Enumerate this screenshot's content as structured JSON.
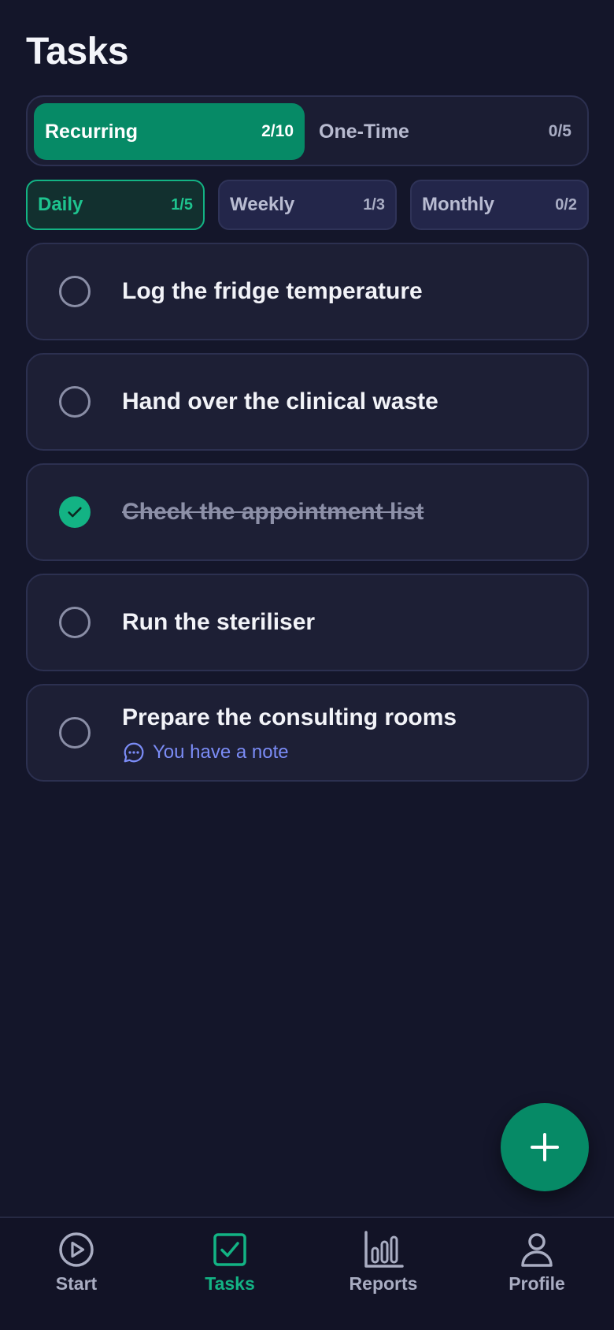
{
  "header": {
    "title": "Tasks"
  },
  "segment": {
    "tabs": [
      {
        "label": "Recurring",
        "count": "2/10",
        "active": true
      },
      {
        "label": "One-Time",
        "count": "0/5",
        "active": false
      }
    ]
  },
  "frequency": {
    "chips": [
      {
        "label": "Daily",
        "count": "1/5",
        "active": true
      },
      {
        "label": "Weekly",
        "count": "1/3",
        "active": false
      },
      {
        "label": "Monthly",
        "count": "0/2",
        "active": false
      }
    ]
  },
  "tasks": [
    {
      "title": "Log the fridge temperature",
      "done": false
    },
    {
      "title": "Hand over the clinical waste",
      "done": false
    },
    {
      "title": "Check the appointment list",
      "done": true
    },
    {
      "title": "Run the steriliser",
      "done": false
    },
    {
      "title": "Prepare the consulting rooms",
      "done": false,
      "note": "You have a note"
    }
  ],
  "fab": {
    "icon": "plus-icon"
  },
  "nav": {
    "items": [
      {
        "label": "Start",
        "icon": "play-circle-icon",
        "active": false
      },
      {
        "label": "Tasks",
        "icon": "checkbox-icon",
        "active": true
      },
      {
        "label": "Reports",
        "icon": "bar-chart-icon",
        "active": false
      },
      {
        "label": "Profile",
        "icon": "user-icon",
        "active": false
      }
    ]
  },
  "colors": {
    "background": "#14162a",
    "accent": "#068a66",
    "accent_bright": "#13b384",
    "note": "#7b8cf6",
    "card": "#1d1f35"
  }
}
